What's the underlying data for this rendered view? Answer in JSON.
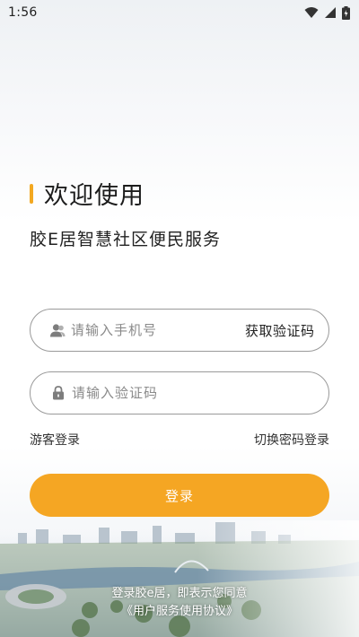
{
  "status_bar": {
    "time": "1:56"
  },
  "header": {
    "title": "欢迎使用",
    "subtitle": "胶E居智慧社区便民服务"
  },
  "form": {
    "phone_placeholder": "请输入手机号",
    "get_code_label": "获取验证码",
    "code_placeholder": "请输入验证码",
    "guest_login_label": "游客登录",
    "switch_password_label": "切换密码登录",
    "login_button_label": "登录"
  },
  "agreement": {
    "text": "登录胶e居，即表示您同意",
    "link": "《用户服务使用协议》"
  },
  "colors": {
    "accent": "#f5a623",
    "text": "#222222",
    "border": "#9a9a9a"
  },
  "icons": {
    "phone_field": "user-icon",
    "code_field": "lock-icon",
    "status": [
      "wifi-icon",
      "signal-icon",
      "battery-icon"
    ]
  }
}
